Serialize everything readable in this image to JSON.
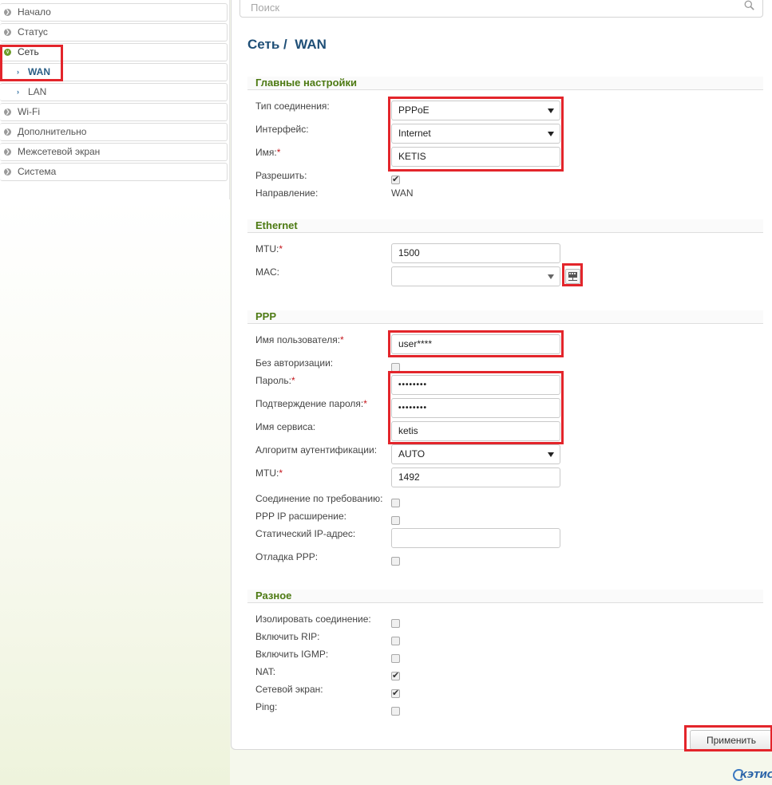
{
  "sidebar": {
    "items": [
      {
        "label": "Начало"
      },
      {
        "label": "Статус"
      },
      {
        "label": "Сеть"
      },
      {
        "label": "WAN"
      },
      {
        "label": "LAN"
      },
      {
        "label": "Wi-Fi"
      },
      {
        "label": "Дополнительно"
      },
      {
        "label": "Межсетевой экран"
      },
      {
        "label": "Система"
      }
    ]
  },
  "search": {
    "placeholder": "Поиск"
  },
  "breadcrumb": {
    "section": "Сеть",
    "separator": "/",
    "page": "WAN"
  },
  "main_settings": {
    "title": "Главные настройки",
    "conn_type_label": "Тип соединения:",
    "conn_type_value": "PPPoE",
    "interface_label": "Интерфейс:",
    "interface_value": "Internet",
    "name_label": "Имя:",
    "name_value": "KETIS",
    "enable_label": "Разрешить:",
    "enable_checked": true,
    "direction_label": "Направление:",
    "direction_value": "WAN"
  },
  "ethernet": {
    "title": "Ethernet",
    "mtu_label": "MTU:",
    "mtu_value": "1500",
    "mac_label": "MAC:",
    "mac_value": ""
  },
  "ppp": {
    "title": "PPP",
    "username_label": "Имя пользователя:",
    "username_value": "user****",
    "no_auth_label": "Без авторизации:",
    "password_label": "Пароль:",
    "password_value": "••••••••",
    "password_confirm_label": "Подтверждение пароля:",
    "password_confirm_value": "••••••••",
    "service_label": "Имя сервиса:",
    "service_value": "ketis",
    "auth_algo_label": "Алгоритм аутентификации:",
    "auth_algo_value": "AUTO",
    "mtu_label": "MTU:",
    "mtu_value": "1492",
    "on_demand_label": "Соединение по требованию:",
    "ip_ext_label": "PPP IP расширение:",
    "static_ip_label": "Статический IP-адрес:",
    "static_ip_value": "",
    "debug_label": "Отладка PPP:"
  },
  "misc": {
    "title": "Разное",
    "isolate_label": "Изолировать соединение:",
    "rip_label": "Включить RIP:",
    "igmp_label": "Включить IGMP:",
    "nat_label": "NAT:",
    "firewall_label": "Сетевой экран:",
    "ping_label": "Ping:"
  },
  "apply_label": "Применить",
  "required_mark": "*",
  "logo_text": "КЭТИС",
  "colors": {
    "highlight": "#e3252b",
    "section_title": "#4d7a13",
    "breadcrumb": "#1f4f77"
  }
}
